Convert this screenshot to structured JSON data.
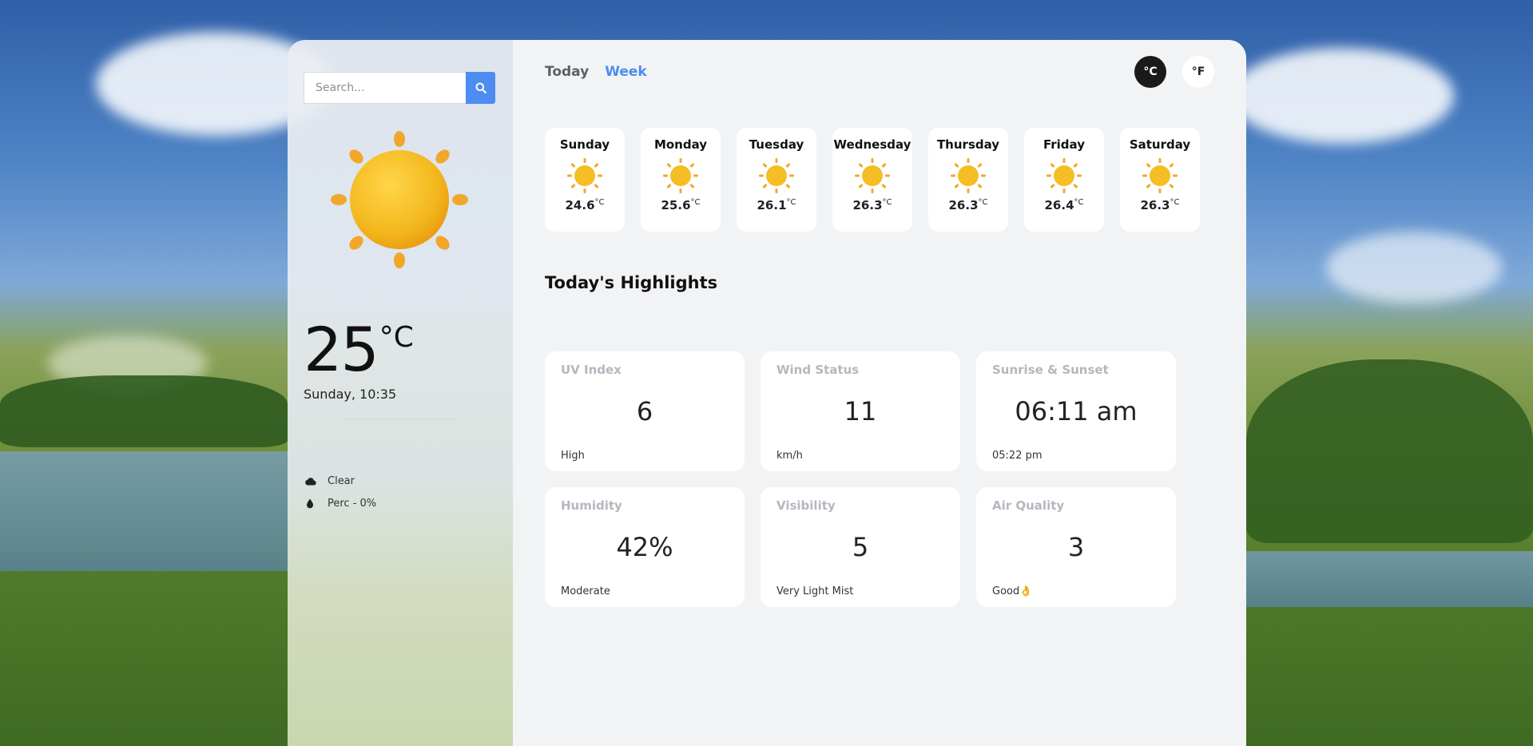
{
  "search": {
    "placeholder": "Search..."
  },
  "current": {
    "temp": "25",
    "unit": "°C",
    "datetime": "Sunday, 10:35",
    "condition": "Clear",
    "precip": "Perc - 0%"
  },
  "tabs": [
    {
      "label": "Today"
    },
    {
      "label": "Week"
    }
  ],
  "units": {
    "celsius": "°C",
    "fahrenheit": "°F"
  },
  "week": [
    {
      "day": "Sunday",
      "temp": "24.6",
      "unit": "°C"
    },
    {
      "day": "Monday",
      "temp": "25.6",
      "unit": "°C"
    },
    {
      "day": "Tuesday",
      "temp": "26.1",
      "unit": "°C"
    },
    {
      "day": "Wednesday",
      "temp": "26.3",
      "unit": "°C"
    },
    {
      "day": "Thursday",
      "temp": "26.3",
      "unit": "°C"
    },
    {
      "day": "Friday",
      "temp": "26.4",
      "unit": "°C"
    },
    {
      "day": "Saturday",
      "temp": "26.3",
      "unit": "°C"
    }
  ],
  "highlights": {
    "title": "Today's Highlights",
    "items": [
      {
        "label": "UV Index",
        "value": "6",
        "sub": "High"
      },
      {
        "label": "Wind Status",
        "value": "11",
        "sub": "km/h"
      },
      {
        "label": "Sunrise & Sunset",
        "value": "06:11 am",
        "sub": "05:22 pm"
      },
      {
        "label": "Humidity",
        "value": "42%",
        "sub": "Moderate"
      },
      {
        "label": "Visibility",
        "value": "5",
        "sub": "Very Light Mist"
      },
      {
        "label": "Air Quality",
        "value": "3",
        "sub": "Good👌"
      }
    ]
  },
  "colors": {
    "accent": "#4d8cf0",
    "sun": "#f3b71c",
    "active_unit": "#1a1a1a"
  },
  "icons": {
    "search": "search-icon",
    "weather": "sun-icon",
    "condition": "cloud-icon",
    "precip": "droplet-icon"
  }
}
